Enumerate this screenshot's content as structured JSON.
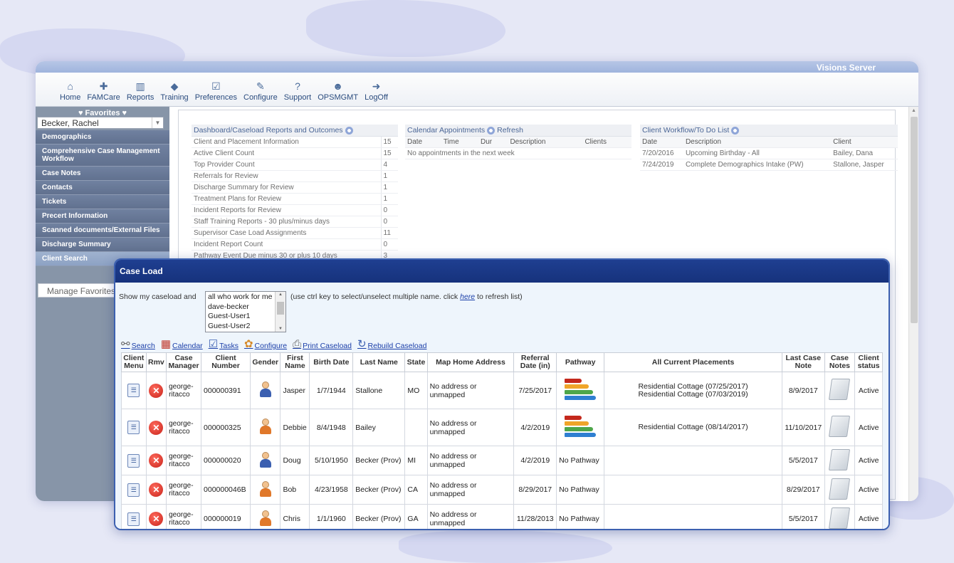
{
  "app": {
    "server_title": "Visions Server"
  },
  "toolbar": {
    "items": [
      {
        "label": "Home",
        "icon": "home-icon"
      },
      {
        "label": "FAMCare",
        "icon": "medkit-icon"
      },
      {
        "label": "Reports",
        "icon": "bar-chart-icon"
      },
      {
        "label": "Training",
        "icon": "graduation-cap-icon"
      },
      {
        "label": "Preferences",
        "icon": "checkbox-icon"
      },
      {
        "label": "Configure",
        "icon": "wrench-icon"
      },
      {
        "label": "Support",
        "icon": "question-icon"
      },
      {
        "label": "OPSMGMT",
        "icon": "users-icon"
      },
      {
        "label": "LogOff",
        "icon": "sign-out-icon"
      }
    ]
  },
  "sidebar": {
    "favorites_label": "♥ Favorites ♥",
    "selected_client": "Becker, Rachel",
    "items": [
      "Demographics",
      "Comprehensive Case Management Workflow",
      "Case Notes",
      "Contacts",
      "Tickets",
      "Precert Information",
      "Scanned documents/External Files",
      "Discharge Summary",
      "Client Search"
    ],
    "manage_favorites": "Manage Favorites"
  },
  "dashboard": {
    "title": "Dashboard/Caseload Reports and Outcomes",
    "rows": [
      {
        "label": "Client and Placement Information",
        "value": "15"
      },
      {
        "label": "Active Client Count",
        "value": "15"
      },
      {
        "label": "Top Provider Count",
        "value": "4"
      },
      {
        "label": "Referrals for Review",
        "value": "1"
      },
      {
        "label": "Discharge Summary for Review",
        "value": "1"
      },
      {
        "label": "Treatment Plans for Review",
        "value": "1"
      },
      {
        "label": "Incident Reports for Review",
        "value": "0"
      },
      {
        "label": "Staff Training Reports - 30 plus/minus days",
        "value": "0"
      },
      {
        "label": "Supervisor Case Load Assignments",
        "value": "11"
      },
      {
        "label": "Incident Report Count",
        "value": "0"
      },
      {
        "label": "Pathway Event Due minus 30 or plus 10 days",
        "value": "3"
      }
    ]
  },
  "calendar": {
    "title": "Calendar Appointments",
    "refresh": "Refresh",
    "headers": [
      "Date",
      "Time",
      "Dur",
      "Description",
      "Clients"
    ],
    "empty": "No appointments in the next week"
  },
  "todo": {
    "title": "Client Workflow/To Do List",
    "headers": [
      "Date",
      "Description",
      "Client"
    ],
    "rows": [
      {
        "date": "7/20/2016",
        "description": "Upcoming Birthday - All",
        "client": "Bailey, Dana"
      },
      {
        "date": "7/24/2019",
        "description": "Complete Demographics Intake (PW)",
        "client": "Stallone, Jasper"
      }
    ]
  },
  "caseload": {
    "title": "Case Load",
    "show_label": "Show my caseload and",
    "options": [
      "all who work for me",
      "dave-becker",
      "Guest-User1",
      "Guest-User2"
    ],
    "hint_prefix": "(use ctrl key to select/unselect multiple name. click",
    "hint_link": "here",
    "hint_suffix": "to refresh list)",
    "actions": [
      "Search",
      "Calendar",
      "Tasks",
      "Configure",
      "Print Caseload",
      "Rebuild Caseload"
    ],
    "columns": [
      "Client Menu",
      "Rmv",
      "Case Manager",
      "Client Number",
      "Gender",
      "First Name",
      "Birth Date",
      "Last Name",
      "State",
      "Map Home Address",
      "Referral Date (in)",
      "Pathway",
      "All Current Placements",
      "Last Case Note",
      "Case Notes",
      "Client status"
    ],
    "rows": [
      {
        "manager": "george-ritacco",
        "number": "000000391",
        "gender": "male",
        "first": "Jasper",
        "birth": "1/7/1944",
        "last": "Stallone",
        "state": "MO",
        "address": "No address or unmapped",
        "referral": "7/25/2017",
        "pathway": "",
        "placements": [
          "Residential Cottage (07/25/2017)",
          "Residential Cottage (07/03/2019)"
        ],
        "last_note": "8/9/2017",
        "status": "Active"
      },
      {
        "manager": "george-ritacco",
        "number": "000000325",
        "gender": "female",
        "first": "Debbie",
        "birth": "8/4/1948",
        "last": "Bailey",
        "state": "",
        "address": "No address or unmapped",
        "referral": "4/2/2019",
        "pathway": "",
        "placements": [
          "Residential Cottage (08/14/2017)"
        ],
        "last_note": "11/10/2017",
        "status": "Active"
      },
      {
        "manager": "george-ritacco",
        "number": "000000020",
        "gender": "male",
        "first": "Doug",
        "birth": "5/10/1950",
        "last": "Becker (Prov)",
        "state": "MI",
        "address": "No address or unmapped",
        "referral": "4/2/2019",
        "pathway": "No Pathway",
        "placements": [],
        "last_note": "5/5/2017",
        "status": "Active"
      },
      {
        "manager": "george-ritacco",
        "number": "000000046B",
        "gender": "female",
        "first": "Bob",
        "birth": "4/23/1958",
        "last": "Becker (Prov)",
        "state": "CA",
        "address": "No address or unmapped",
        "referral": "8/29/2017",
        "pathway": "No Pathway",
        "placements": [],
        "last_note": "8/29/2017",
        "status": "Active"
      },
      {
        "manager": "george-ritacco",
        "number": "000000019",
        "gender": "female",
        "first": "Chris",
        "birth": "1/1/1960",
        "last": "Becker (Prov)",
        "state": "GA",
        "address": "No address or unmapped",
        "referral": "11/28/2013",
        "pathway": "No Pathway",
        "placements": [],
        "last_note": "5/5/2017",
        "status": "Active"
      }
    ]
  },
  "colors": {
    "accent": "#16327c",
    "nav": "#61718f",
    "link": "#1a3ea8",
    "remove": "#c8231b"
  }
}
